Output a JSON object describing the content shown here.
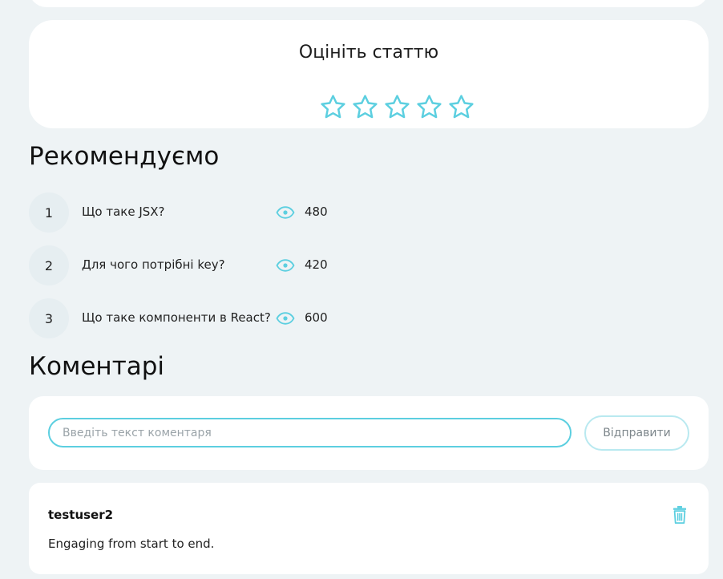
{
  "rating": {
    "title": "Оцініть статтю",
    "stars_total": 5,
    "stars_selected": 0,
    "accent_color": "#5ccfe0"
  },
  "recommended": {
    "title": "Рекомендуємо",
    "items": [
      {
        "number": "1",
        "label": "Що таке JSX?",
        "views": "480"
      },
      {
        "number": "2",
        "label": "Для чого потрібні key?",
        "views": "420"
      },
      {
        "number": "3",
        "label": "Що таке компоненти в React?",
        "views": "600"
      }
    ],
    "view_icon": "eye-icon"
  },
  "comments": {
    "title": "Коментарі",
    "input_value": "",
    "input_placeholder": "Введіть текст коментаря",
    "send_label": "Відправити",
    "list": [
      {
        "author": "testuser2",
        "text": "Engaging from start to end."
      }
    ],
    "delete_icon": "trash-icon"
  }
}
